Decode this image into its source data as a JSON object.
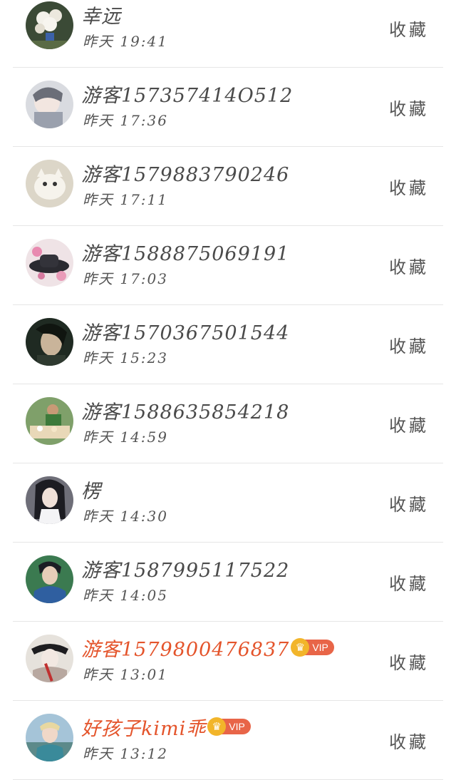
{
  "items": [
    {
      "name": "幸远",
      "time": "昨天 19:41",
      "action": "收藏",
      "vip": false,
      "vip_label": "",
      "avatar": "flower-vase-avatar"
    },
    {
      "name": "游客157357414O512",
      "time": "昨天 17:36",
      "action": "收藏",
      "vip": false,
      "vip_label": "",
      "avatar": "anime-girl-avatar"
    },
    {
      "name": "游客1579883790246",
      "time": "昨天 17:11",
      "action": "收藏",
      "vip": false,
      "vip_label": "",
      "avatar": "cat-avatar"
    },
    {
      "name": "游客1588875069191",
      "time": "昨天 17:03",
      "action": "收藏",
      "vip": false,
      "vip_label": "",
      "avatar": "hat-flowers-avatar"
    },
    {
      "name": "游客1570367501544",
      "time": "昨天 15:23",
      "action": "收藏",
      "vip": false,
      "vip_label": "",
      "avatar": "dark-figure-avatar"
    },
    {
      "name": "游客1588635854218",
      "time": "昨天 14:59",
      "action": "收藏",
      "vip": false,
      "vip_label": "",
      "avatar": "person-table-avatar"
    },
    {
      "name": "楞",
      "time": "昨天 14:30",
      "action": "收藏",
      "vip": false,
      "vip_label": "",
      "avatar": "girl-portrait-avatar"
    },
    {
      "name": "游客1587995117522",
      "time": "昨天 14:05",
      "action": "收藏",
      "vip": false,
      "vip_label": "",
      "avatar": "man-blue-avatar"
    },
    {
      "name": "游客1579800476837",
      "time": "昨天 13:01",
      "action": "收藏",
      "vip": true,
      "vip_label": "VIP",
      "avatar": "costume-figure-avatar"
    },
    {
      "name": "好孩子kimi乖",
      "time": "昨天 13:12",
      "action": "收藏",
      "vip": true,
      "vip_label": "VIP",
      "avatar": "child-outdoor-avatar"
    }
  ],
  "colors": {
    "name": "#4a4a4a",
    "vip_name": "#e4542b",
    "vip_badge": "#e86548",
    "crown": "#f2b52a",
    "divider": "#e6e6e6"
  }
}
